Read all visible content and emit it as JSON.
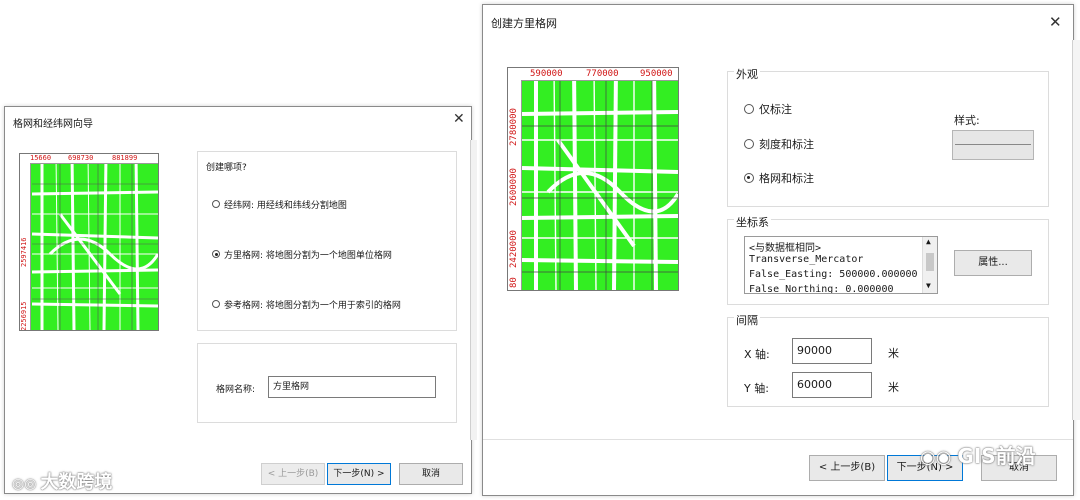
{
  "left_dialog": {
    "title": "格网和经纬网向导",
    "group_title": "创建哪项?",
    "options": [
      {
        "label": "经纬网: 用经线和纬线分割地图",
        "selected": false
      },
      {
        "label": "方里格网: 将地图分割为一个地图单位格网",
        "selected": true
      },
      {
        "label": "参考格网: 将地图分割为一个用于索引的格网",
        "selected": false
      }
    ],
    "grid_name_label": "格网名称:",
    "grid_name_value": "方里格网",
    "back_button": "< 上一步(B)",
    "next_button": "下一步(N) >",
    "cancel_button": "取消",
    "preview": {
      "top_labels": [
        "15660",
        "698730",
        "881899"
      ],
      "left_labels": [
        "2597416",
        "2256915"
      ]
    }
  },
  "right_dialog": {
    "title": "创建方里格网",
    "appearance": {
      "title": "外观",
      "options": [
        {
          "label": "仅标注",
          "selected": false
        },
        {
          "label": "刻度和标注",
          "selected": false
        },
        {
          "label": "格网和标注",
          "selected": true
        }
      ],
      "style_label": "样式:"
    },
    "coord_system": {
      "title": "坐标系",
      "lines": [
        "<与数据框相同>",
        "Transverse_Mercator",
        "False_Easting: 500000.000000",
        "False_Northing: 0.000000"
      ],
      "properties_button": "属性..."
    },
    "interval": {
      "title": "间隔",
      "x_label": "X 轴:",
      "x_value": "90000",
      "y_label": "Y 轴:",
      "y_value": "60000",
      "unit": "米"
    },
    "back_button": "< 上一步(B)",
    "next_button": "下一步(N) >",
    "cancel_button": "取消",
    "preview": {
      "top_labels": [
        "590000",
        "770000",
        "950000"
      ],
      "left_labels": [
        "2780000",
        "2600000",
        "2420000",
        "80"
      ]
    }
  },
  "watermarks": {
    "left": "大数跨境",
    "right": "GIS前沿"
  },
  "colors": {
    "map_green": "#33ee22",
    "tick_red": "#d01515",
    "accent_blue": "#0078d7"
  }
}
